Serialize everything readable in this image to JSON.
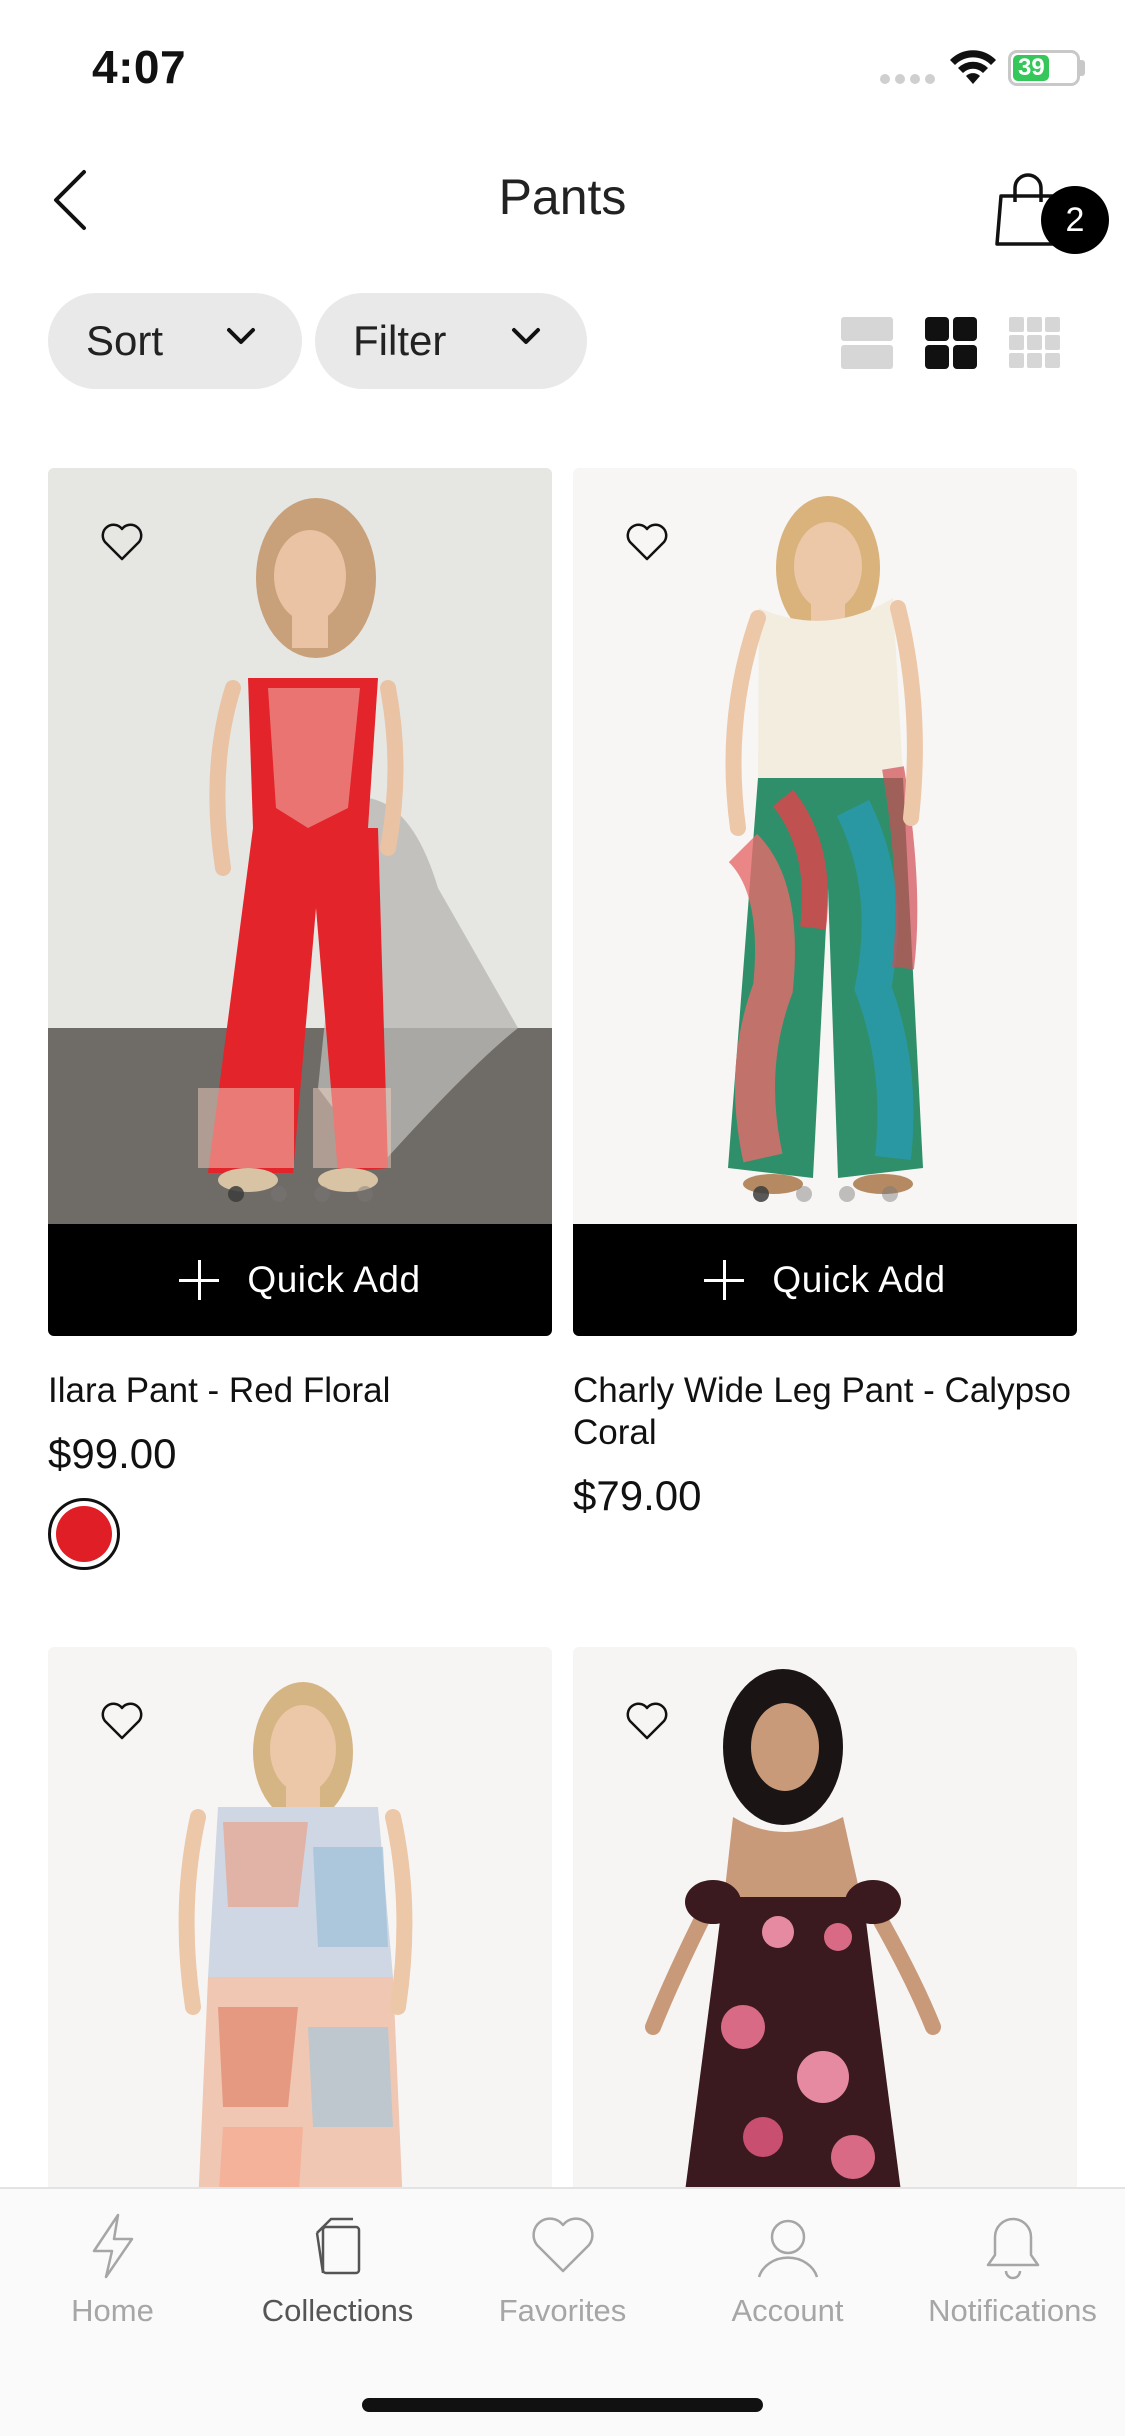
{
  "status_bar": {
    "time": "4:07",
    "battery": "39"
  },
  "header": {
    "title": "Pants",
    "bag_count": "2"
  },
  "toolbar": {
    "sort_label": "Sort",
    "filter_label": "Filter"
  },
  "products": [
    {
      "name": "Ilara Pant - Red Floral",
      "price": "$99.00",
      "quick_add": "Quick Add",
      "swatch_color": "#e01e25",
      "image_colors": [
        "#e8e8e6",
        "#e3242b"
      ]
    },
    {
      "name": "Charly Wide Leg Pant - Calypso Coral",
      "price": "$79.00",
      "quick_add": "Quick Add",
      "image_colors": [
        "#f7f6f4",
        "#2f8f6a"
      ]
    },
    {
      "image_colors": [
        "#f6f5f3",
        "#e8a48b"
      ]
    },
    {
      "image_colors": [
        "#f6f5f3",
        "#3a1a1e"
      ]
    }
  ],
  "tabs": [
    {
      "label": "Home",
      "icon": "lightning-icon"
    },
    {
      "label": "Collections",
      "icon": "collections-icon"
    },
    {
      "label": "Favorites",
      "icon": "heart-icon"
    },
    {
      "label": "Account",
      "icon": "person-icon"
    },
    {
      "label": "Notifications",
      "icon": "bell-icon"
    }
  ]
}
